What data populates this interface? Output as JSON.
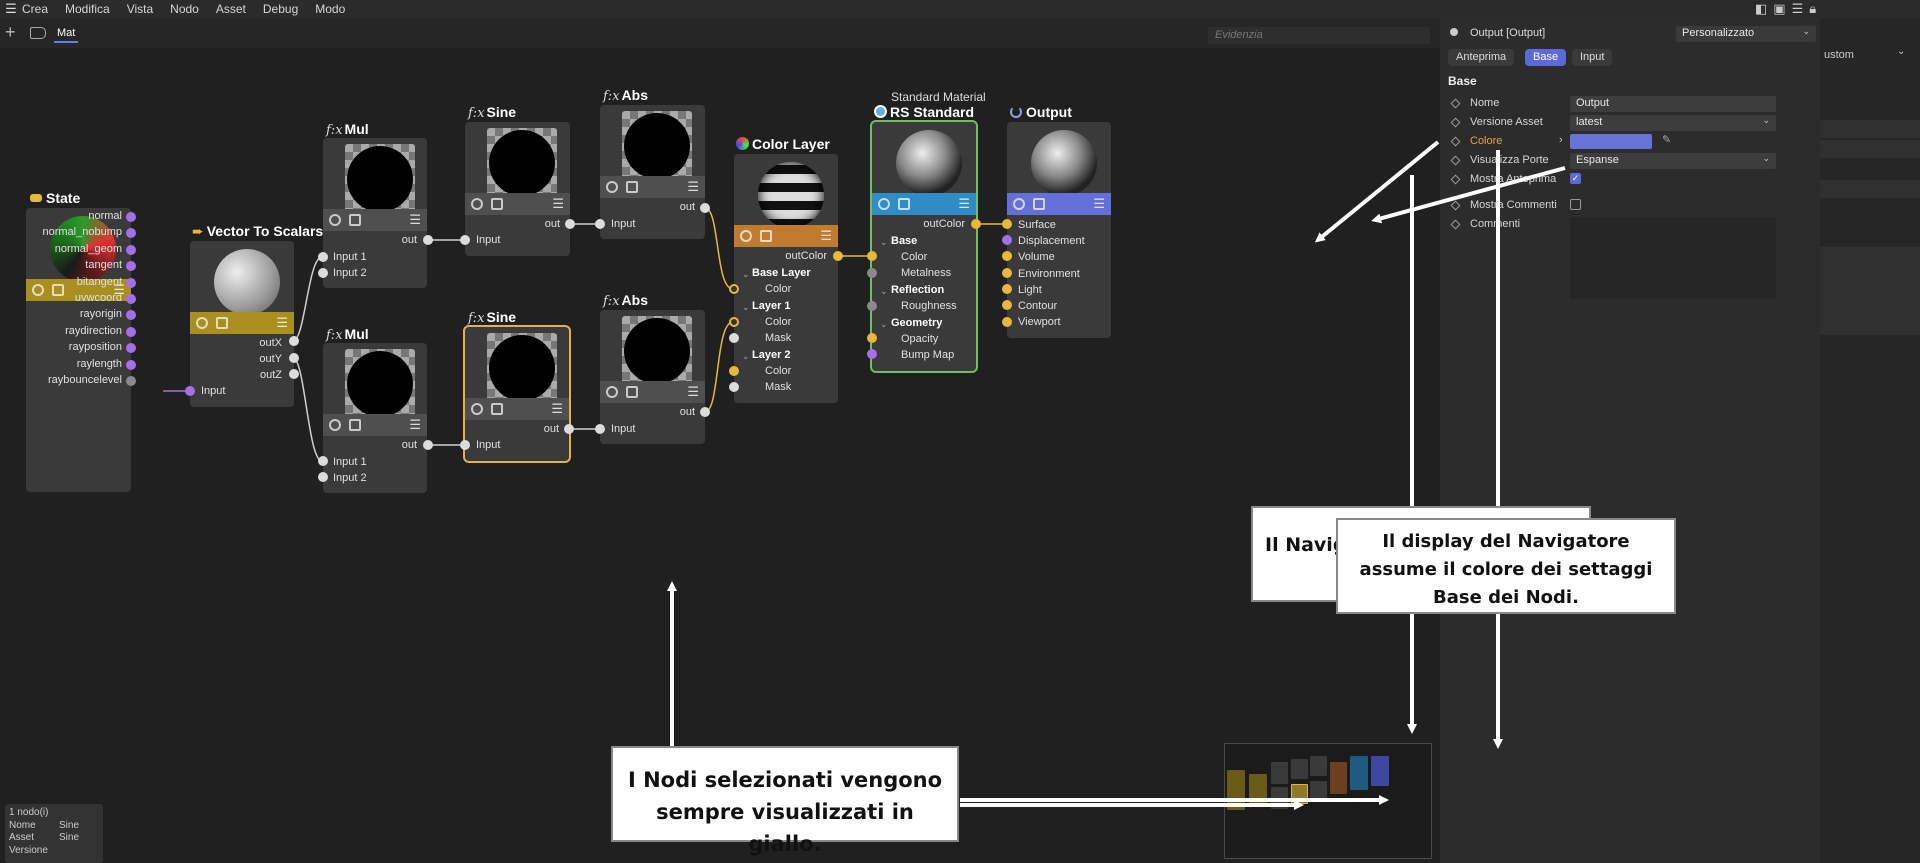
{
  "menu": [
    "Crea",
    "Modifica",
    "Vista",
    "Nodo",
    "Asset",
    "Debug",
    "Modo"
  ],
  "tab": {
    "label": "Mat"
  },
  "search": {
    "placeholder": "Evidenzia"
  },
  "nodes": {
    "state": {
      "title": "State",
      "ports": [
        "normal",
        "normal_nobump",
        "normal_geom",
        "tangent",
        "bitangent",
        "uvwcoord",
        "rayorigin",
        "raydirection",
        "rayposition",
        "raylength",
        "raybouncelevel"
      ]
    },
    "vts": {
      "title": "Vector To Scalars",
      "in": "Input",
      "outs": [
        "outX",
        "outY",
        "outZ"
      ]
    },
    "mul1": {
      "fx": "f:x",
      "title": "Mul",
      "out": "out",
      "ins": [
        "Input 1",
        "Input 2"
      ]
    },
    "mul2": {
      "fx": "f:x",
      "title": "Mul",
      "out": "out",
      "ins": [
        "Input 1",
        "Input 2"
      ]
    },
    "sine1": {
      "fx": "f:x",
      "title": "Sine",
      "out": "out",
      "in": "Input"
    },
    "sine2": {
      "fx": "f:x",
      "title": "Sine",
      "out": "out",
      "in": "Input"
    },
    "abs1": {
      "fx": "f:x",
      "title": "Abs",
      "out": "out",
      "in": "Input"
    },
    "abs2": {
      "fx": "f:x",
      "title": "Abs",
      "out": "out",
      "in": "Input"
    },
    "colorlayer": {
      "title": "Color Layer",
      "out": "outColor",
      "s1": "Base Layer",
      "s1p": [
        "Color"
      ],
      "s2": "Layer 1",
      "s2p": [
        "Color",
        "Mask"
      ],
      "s3": "Layer 2",
      "s3p": [
        "Color",
        "Mask"
      ]
    },
    "rs": {
      "subtitle": "Standard Material",
      "title": "RS Standard",
      "out": "outColor",
      "s1": "Base",
      "s1p": [
        "Color",
        "Metalness"
      ],
      "s2": "Reflection",
      "s2p": [
        "Roughness"
      ],
      "s3": "Geometry",
      "s3p": [
        "Opacity",
        "Bump Map"
      ]
    },
    "output": {
      "title": "Output",
      "ins": [
        "Surface",
        "Displacement",
        "Volume",
        "Environment",
        "Light",
        "Contour",
        "Viewport"
      ]
    }
  },
  "info": {
    "count": "1 nodo(i)",
    "rows": [
      [
        "Nome",
        "Sine"
      ],
      [
        "Asset",
        "Sine"
      ],
      [
        "Versione",
        ""
      ]
    ]
  },
  "panel": {
    "title": "Output [Output]",
    "preset": "Personalizzato",
    "tabs": [
      "Anteprima",
      "Base",
      "Input"
    ],
    "section": "Base",
    "fields": {
      "nome": {
        "label": "Nome",
        "value": "Output"
      },
      "versione": {
        "label": "Versione Asset",
        "value": "latest"
      },
      "colore": {
        "label": "Colore",
        "value": "#6673d9"
      },
      "porte": {
        "label": "Visualizza Porte",
        "value": "Espanse"
      },
      "mostra_anteprima": {
        "label": "Mostra Anteprima"
      },
      "mostra_commenti": {
        "label": "Mostra Commenti"
      },
      "commenti": {
        "label": "Commenti"
      }
    },
    "far_right": "ustom"
  },
  "callouts": {
    "back": "Il Navig dai s",
    "front": "Il display del Navigatore assume il colore dei settaggi Base dei Nodi.",
    "bottom": "I Nodi selezionati vengono sempre visualizzati in giallo."
  },
  "colors": {
    "state_bar": "#a88f1f",
    "vts_bar": "#a88f1f",
    "colorlayer_bar": "#c17b2f",
    "rs_bar": "#2f8cc5",
    "output_bar": "#6470d8",
    "fx_bar": "#4f4f4f",
    "selected": "#e5b24a",
    "accent": "#5b6ad8"
  }
}
